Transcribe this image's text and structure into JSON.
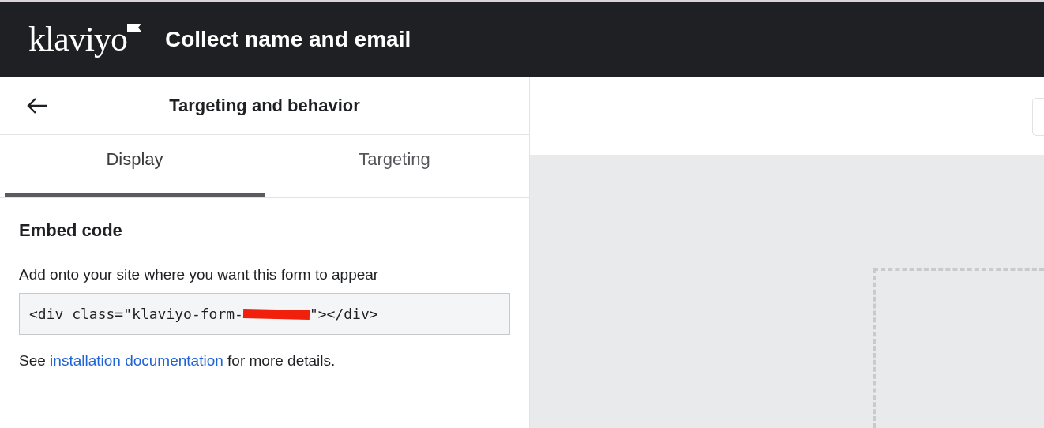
{
  "header": {
    "logo": "klaviyo",
    "title": "Collect name and email"
  },
  "panel": {
    "title": "Targeting and behavior",
    "tabs": [
      {
        "label": "Display",
        "selected": true
      },
      {
        "label": "Targeting",
        "selected": false
      }
    ],
    "section": {
      "heading": "Embed code",
      "description": "Add onto your site where you want this form to appear",
      "code": {
        "before": "<div class=\"klaviyo-form-",
        "redacted": true,
        "after": "\"></div>"
      },
      "note": {
        "before": "See",
        "link": "installation documentation",
        "after": "for more details."
      }
    }
  }
}
